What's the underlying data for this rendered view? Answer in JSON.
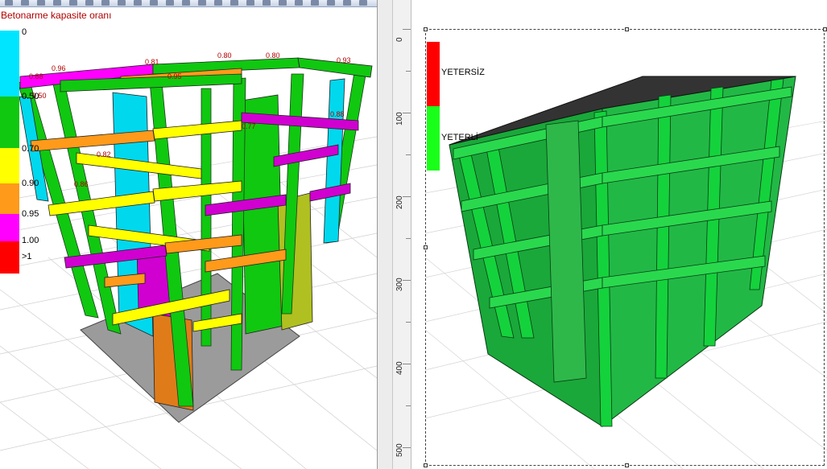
{
  "left": {
    "legend_title": "Betonarme kapasite oranı",
    "legend": [
      {
        "label": "0",
        "color": "#00e5ff"
      },
      {
        "label": "0.50",
        "color": "#10c810"
      },
      {
        "label": "0.70",
        "color": "#ffff00"
      },
      {
        "label": "0.90",
        "color": "#ff9a1a"
      },
      {
        "label": "0.95",
        "color": "#ff00ff"
      },
      {
        "label": "1.00",
        "color": "#ff0000"
      },
      {
        "label": ">1",
        "color": "#ff0000"
      }
    ],
    "beam_labels": [
      "0.96",
      "0.88",
      "0.81",
      "0.80",
      "0.80",
      "0.93",
      "0.50",
      "0.95",
      "0.77",
      "0.88",
      "0.82",
      "0.86"
    ]
  },
  "right": {
    "ruler": [
      "0",
      "100",
      "200",
      "300",
      "400",
      "500"
    ],
    "legend": [
      {
        "label": "YETERSİZ",
        "color": "#ff0000"
      },
      {
        "label": "YETERLİ",
        "color": "#1aff1a"
      }
    ]
  }
}
